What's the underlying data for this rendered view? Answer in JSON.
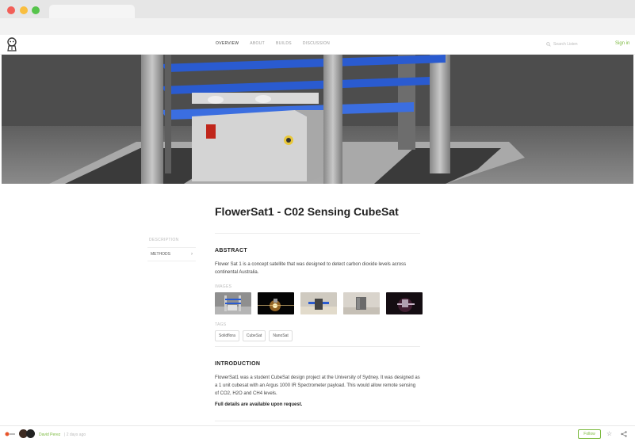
{
  "nav": {
    "links": [
      "Overview",
      "About",
      "Builds",
      "Discussion"
    ],
    "search_placeholder": "Search Listen",
    "signin": "Sign in"
  },
  "project": {
    "title": "FlowerSat1 - C02 Sensing CubeSat"
  },
  "sidebar": {
    "heading": "Description",
    "items": [
      {
        "label": "Methods"
      }
    ]
  },
  "abstract": {
    "title": "ABSTRACT",
    "text": "Flower Sat 1 is a concept satellite that was designed to detect carbon dioxide levels across continental Australia.",
    "images_label": "Images",
    "tags_label": "Tags",
    "tags": [
      "Solidflora",
      "CubeSat",
      "NanoSat"
    ]
  },
  "introduction": {
    "title": "INTRODUCTION",
    "text": "FlowerSat1 was a student CubeSat design project at the University of Sydney. It was designed as a 1 unit cubesat with an Argus 1000 IR Spectrometer payload. This would allow remote sensing of CO2, H2O and CH4 levels.",
    "bold": "Full details are available upon request."
  },
  "footer": {
    "author": "David Perez",
    "time": "| 2 days ago",
    "follow": "Follow"
  },
  "colors": {
    "accent": "#7bb93e",
    "panel_blue": "#2a5bd0"
  }
}
